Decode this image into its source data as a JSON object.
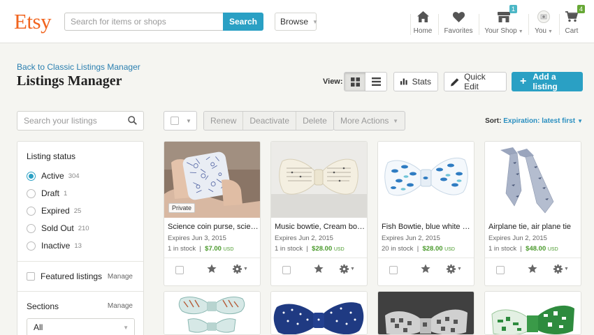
{
  "header": {
    "logo": "Etsy",
    "search_placeholder": "Search for items or shops",
    "search_button": "Search",
    "browse": "Browse",
    "nav": {
      "home": "Home",
      "favorites": "Favorites",
      "your_shop": "Your Shop",
      "your_shop_badge": "1",
      "you": "You",
      "cart": "Cart",
      "cart_badge": "4"
    }
  },
  "page": {
    "back_link": "Back to Classic Listings Manager",
    "title": "Listings Manager",
    "view_label": "View:",
    "stats_button": "Stats",
    "quick_edit_button": "Quick Edit",
    "add_listing_button": "Add a listing"
  },
  "sidebar": {
    "search_placeholder": "Search your listings",
    "listing_status_heading": "Listing status",
    "statuses": [
      {
        "label": "Active",
        "count": "304",
        "selected": true
      },
      {
        "label": "Draft",
        "count": "1",
        "selected": false
      },
      {
        "label": "Expired",
        "count": "25",
        "selected": false
      },
      {
        "label": "Sold Out",
        "count": "210",
        "selected": false
      },
      {
        "label": "Inactive",
        "count": "13",
        "selected": false
      }
    ],
    "featured_label": "Featured listings",
    "featured_manage": "Manage",
    "sections_heading": "Sections",
    "sections_manage": "Manage",
    "sections_value": "All"
  },
  "actions": {
    "renew": "Renew",
    "deactivate": "Deactivate",
    "delete": "Delete",
    "more_actions": "More Actions",
    "sort_label": "Sort:",
    "sort_value": "Expiration: latest first"
  },
  "listings": [
    {
      "title": "Science coin purse, science gift",
      "expires": "Expires Jun 3, 2015",
      "stock": "1 in stock",
      "price": "$7.00",
      "currency": "USD",
      "private_label": "Private"
    },
    {
      "title": "Music bowtie, Cream bow tie",
      "expires": "Expires Jun 2, 2015",
      "stock": "1 in stock",
      "price": "$28.00",
      "currency": "USD"
    },
    {
      "title": "Fish Bowtie, blue white bow tie",
      "expires": "Expires Jun 2, 2015",
      "stock": "20 in stock",
      "price": "$28.00",
      "currency": "USD"
    },
    {
      "title": "Airplane tie, air plane tie",
      "expires": "Expires Jun 2, 2015",
      "stock": "1 in stock",
      "price": "$48.00",
      "currency": "USD"
    }
  ],
  "colors": {
    "brand": "#f1641e",
    "accent": "#2aa0c4",
    "price": "#4a9a2c"
  }
}
